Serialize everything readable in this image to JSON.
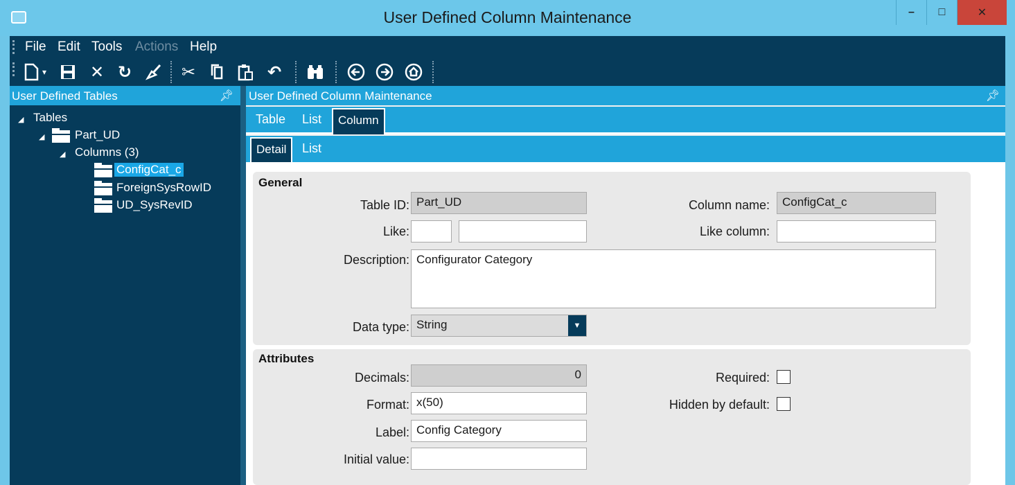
{
  "window": {
    "title": "User Defined Column Maintenance",
    "controls": {
      "minimize": "–",
      "maximize": "□",
      "close": "✕"
    }
  },
  "menu": {
    "items": [
      "File",
      "Edit",
      "Tools",
      "Actions",
      "Help"
    ],
    "disabled": [
      "Actions"
    ]
  },
  "toolbar": {
    "icons": [
      "new-icon",
      "save-icon",
      "delete-icon",
      "refresh-icon",
      "clear-icon",
      "cut-icon",
      "copy-icon",
      "paste-icon",
      "undo-icon",
      "search-icon",
      "back-icon",
      "forward-icon",
      "home-icon"
    ]
  },
  "left_panel": {
    "title": "User Defined Tables",
    "tree": {
      "root": "Tables",
      "table": "Part_UD",
      "columns_node": "Columns (3)",
      "columns": [
        "ConfigCat_c",
        "ForeignSysRowID",
        "UD_SysRevID"
      ],
      "selected": "ConfigCat_c"
    }
  },
  "right_panel": {
    "title": "User Defined Column Maintenance",
    "tabs": [
      "Table",
      "List",
      "Column"
    ],
    "active_tab": "Column",
    "subtabs": [
      "Detail",
      "List"
    ],
    "active_subtab": "Detail"
  },
  "general": {
    "title": "General",
    "table_id_label": "Table ID:",
    "table_id": "Part_UD",
    "column_name_label": "Column name:",
    "column_name": "ConfigCat_c",
    "like_label": "Like:",
    "like_value_1": "",
    "like_value_2": "",
    "like_column_label": "Like column:",
    "like_column": "",
    "description_label": "Description:",
    "description": "Configurator Category",
    "data_type_label": "Data type:",
    "data_type": "String"
  },
  "attributes": {
    "title": "Attributes",
    "decimals_label": "Decimals:",
    "decimals": "0",
    "format_label": "Format:",
    "format": "x(50)",
    "label_label": "Label:",
    "label": "Config Category",
    "initial_value_label": "Initial value:",
    "initial_value": "",
    "required_label": "Required:",
    "required": false,
    "hidden_label": "Hidden by default:",
    "hidden": false
  },
  "colors": {
    "title_bar": "#6cc7ea",
    "dark_navy": "#063b5a",
    "accent_blue": "#20a4da",
    "selection": "#1aa7e6",
    "close_red": "#c9453a"
  }
}
